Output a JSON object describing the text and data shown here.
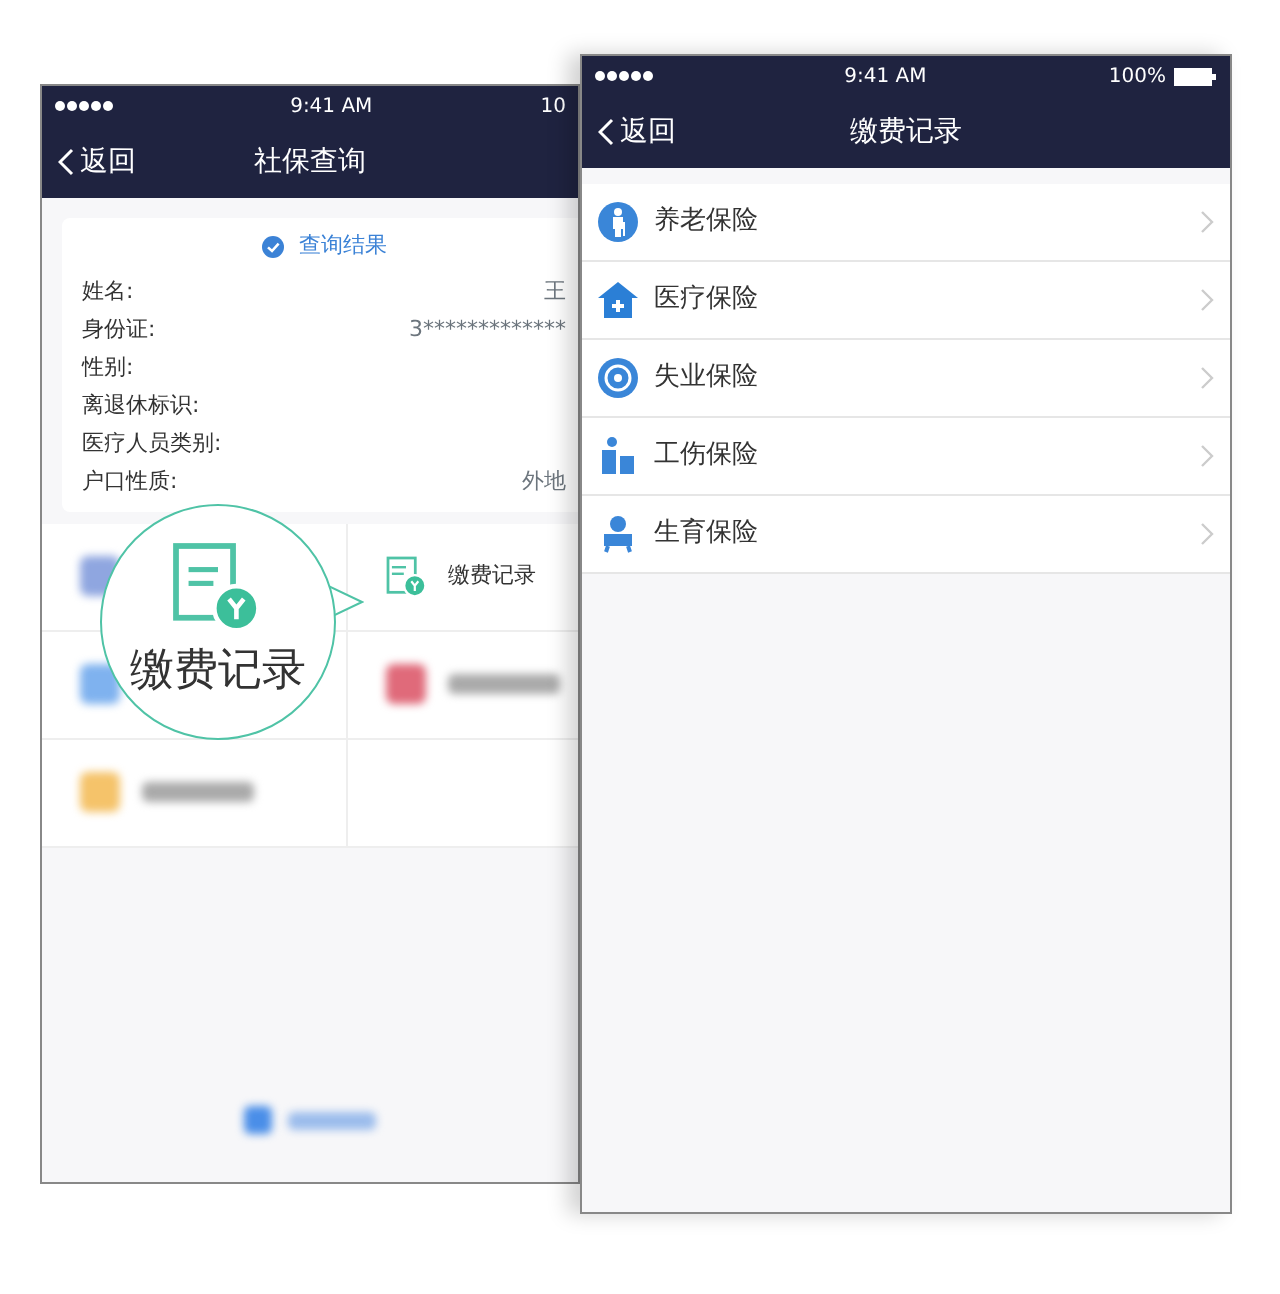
{
  "back_screen": {
    "status_bar": {
      "time": "9:41 AM",
      "battery": "10"
    },
    "nav": {
      "back": "返回",
      "title": "社保查询"
    },
    "result_card": {
      "title": "查询结果",
      "fields": [
        {
          "label": "姓名:",
          "value": "王"
        },
        {
          "label": "身份证:",
          "value": "3*************"
        },
        {
          "label": "性别:"
        },
        {
          "label": "离退休标识:"
        },
        {
          "label": "医疗人员类别:"
        },
        {
          "label": "户口性质:",
          "value": "外地"
        }
      ]
    },
    "tiles": [
      {
        "kind": "icon_only",
        "color": "#8fa6e0"
      },
      {
        "kind": "record",
        "label": "缴费记录"
      },
      {
        "kind": "icon_only",
        "color": "#7fb2ef"
      },
      {
        "kind": "blurred",
        "color": "#e06a7a"
      },
      {
        "kind": "blurred",
        "color": "#f5c36a"
      },
      {
        "kind": "empty"
      }
    ],
    "callout": {
      "label": "缴费记录"
    },
    "footer": {
      "color": "#4a8ee8"
    }
  },
  "front_screen": {
    "status_bar": {
      "time": "9:41 AM",
      "battery": "100%"
    },
    "nav": {
      "back": "返回",
      "title": "缴费记录"
    },
    "items": [
      {
        "kind": "pension",
        "label": "养老保险"
      },
      {
        "kind": "medical",
        "label": "医疗保险"
      },
      {
        "kind": "unemployment",
        "label": "失业保险"
      },
      {
        "kind": "injury",
        "label": "工伤保险"
      },
      {
        "kind": "maternity",
        "label": "生育保险"
      }
    ]
  }
}
